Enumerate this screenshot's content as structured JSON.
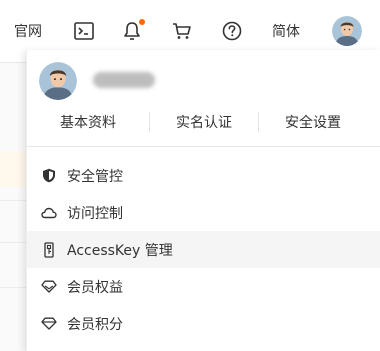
{
  "topbar": {
    "console_label": "官网",
    "language_label": "简体",
    "icons": [
      "terminal-icon",
      "bell-icon",
      "cart-icon",
      "help-icon"
    ],
    "notification_dot_color": "#ff6a00"
  },
  "user": {
    "avatar": "avatar-icon"
  },
  "tabs": [
    {
      "label": "基本资料"
    },
    {
      "label": "实名认证"
    },
    {
      "label": "安全设置"
    }
  ],
  "menu": [
    {
      "label": "安全管控",
      "icon": "shield-icon"
    },
    {
      "label": "访问控制",
      "icon": "cloud-icon"
    },
    {
      "label": "AccessKey 管理",
      "icon": "key-icon",
      "hovered": true
    },
    {
      "label": "会员权益",
      "icon": "diamond-icon"
    },
    {
      "label": "会员积分",
      "icon": "diamond-points-icon"
    }
  ]
}
